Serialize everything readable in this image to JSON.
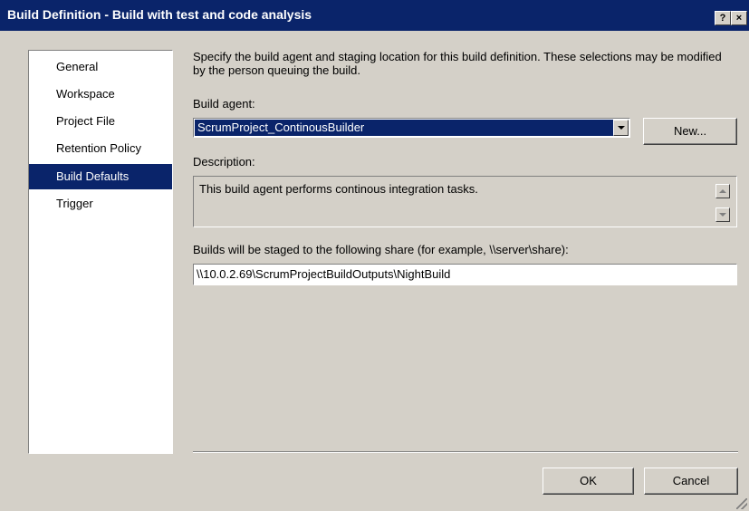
{
  "window": {
    "title": "Build Definition - Build with test and code analysis",
    "help_label": "?",
    "close_label": "×"
  },
  "nav": {
    "items": [
      {
        "label": "General",
        "selected": false
      },
      {
        "label": "Workspace",
        "selected": false
      },
      {
        "label": "Project File",
        "selected": false
      },
      {
        "label": "Retention Policy",
        "selected": false
      },
      {
        "label": "Build Defaults",
        "selected": true
      },
      {
        "label": "Trigger",
        "selected": false
      }
    ]
  },
  "content": {
    "intro": "Specify the build agent and staging location for this build definition. These selections may be modified by the person queuing the build.",
    "build_agent_label": "Build agent:",
    "build_agent_value": "ScrumProject_ContinousBuilder",
    "new_button": "New...",
    "description_label": "Description:",
    "description_text": "This build agent performs continous integration tasks.",
    "share_label": "Builds will be staged to the following share (for example, \\\\server\\share):",
    "share_value": "\\\\10.0.2.69\\ScrumProjectBuildOutputs\\NightBuild"
  },
  "footer": {
    "ok_button": "OK",
    "cancel_button": "Cancel"
  },
  "colors": {
    "title_bar": "#0a246a",
    "selection": "#0a246a",
    "dialog_bg": "#d4d0c8"
  },
  "icons": [
    "help-icon",
    "close-icon",
    "dropdown-arrow-icon",
    "scroll-up-icon",
    "scroll-down-icon",
    "resize-grip-icon"
  ]
}
